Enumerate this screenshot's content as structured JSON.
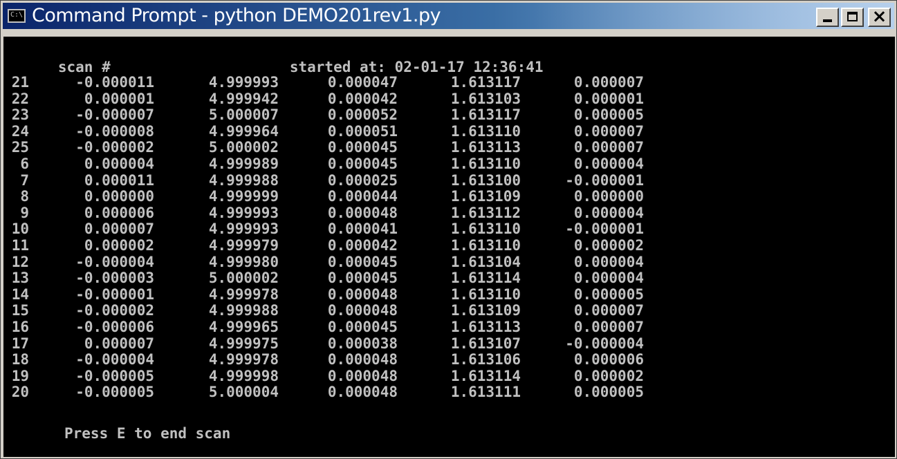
{
  "window": {
    "title": "Command Prompt - python DEMO201rev1.py",
    "icon": "cmd-icon",
    "icon_label": "C:\\",
    "buttons": {
      "minimize": "minimize-icon",
      "maximize": "maximize-icon",
      "close": "close-icon",
      "close_glyph": "×"
    }
  },
  "console": {
    "header_scan": "scan #",
    "header_started": "started at: 02-01-17 12:36:41",
    "rows": [
      [
        "21",
        "-0.000011",
        "4.999993",
        "0.000047",
        "1.613117",
        "0.000007"
      ],
      [
        "22",
        "0.000001",
        "4.999942",
        "0.000042",
        "1.613103",
        "0.000001"
      ],
      [
        "23",
        "-0.000007",
        "5.000007",
        "0.000052",
        "1.613117",
        "0.000005"
      ],
      [
        "24",
        "-0.000008",
        "4.999964",
        "0.000051",
        "1.613110",
        "0.000007"
      ],
      [
        "25",
        "-0.000002",
        "5.000002",
        "0.000045",
        "1.613113",
        "0.000007"
      ],
      [
        "6",
        "0.000004",
        "4.999989",
        "0.000045",
        "1.613110",
        "0.000004"
      ],
      [
        "7",
        "0.000011",
        "4.999988",
        "0.000025",
        "1.613100",
        "-0.000001"
      ],
      [
        "8",
        "0.000000",
        "4.999999",
        "0.000044",
        "1.613109",
        "0.000000"
      ],
      [
        "9",
        "0.000006",
        "4.999993",
        "0.000048",
        "1.613112",
        "0.000004"
      ],
      [
        "10",
        "0.000007",
        "4.999993",
        "0.000041",
        "1.613110",
        "-0.000001"
      ],
      [
        "11",
        "0.000002",
        "4.999979",
        "0.000042",
        "1.613110",
        "0.000002"
      ],
      [
        "12",
        "-0.000004",
        "4.999980",
        "0.000045",
        "1.613104",
        "0.000004"
      ],
      [
        "13",
        "-0.000003",
        "5.000002",
        "0.000045",
        "1.613114",
        "0.000004"
      ],
      [
        "14",
        "-0.000001",
        "4.999978",
        "0.000048",
        "1.613110",
        "0.000005"
      ],
      [
        "15",
        "-0.000002",
        "4.999988",
        "0.000048",
        "1.613109",
        "0.000007"
      ],
      [
        "16",
        "-0.000006",
        "4.999965",
        "0.000045",
        "1.613113",
        "0.000007"
      ],
      [
        "17",
        "0.000007",
        "4.999975",
        "0.000038",
        "1.613107",
        "-0.000004"
      ],
      [
        "18",
        "-0.000004",
        "4.999978",
        "0.000048",
        "1.613106",
        "0.000006"
      ],
      [
        "19",
        "-0.000005",
        "4.999998",
        "0.000048",
        "1.613114",
        "0.000002"
      ],
      [
        "20",
        "-0.000005",
        "5.000004",
        "0.000048",
        "1.613111",
        "0.000005"
      ]
    ],
    "footer_prompt": "Press E to end scan"
  },
  "colors": {
    "console_bg": "#000000",
    "console_text": "#c0c0c0",
    "titlebar_start": "#0a246a",
    "titlebar_end": "#a6caf0"
  }
}
